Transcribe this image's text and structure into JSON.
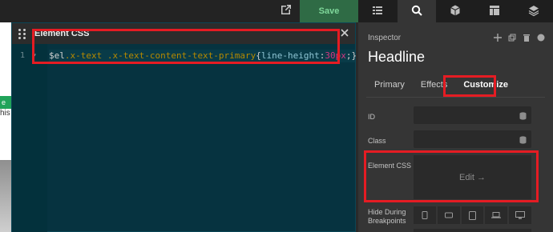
{
  "toolbar": {
    "save_label": "Save"
  },
  "inspector_tabs_icons": [
    "list-icon",
    "search-icon",
    "cube-icon",
    "layout-icon",
    "layers-icon"
  ],
  "background_page": {
    "green_label": "e",
    "text_fragment": "his"
  },
  "editor": {
    "title": "Element CSS",
    "line_number": "1",
    "code": {
      "var": "$el",
      "selector": ".x-text .x-text-content-text-primary",
      "open_brace": "{",
      "property": "line-height",
      "colon": ":",
      "value": "30px",
      "semicolon": ";",
      "close_brace": "}"
    }
  },
  "inspector": {
    "label": "Inspector",
    "title": "Headline",
    "tabs": [
      {
        "label": "Primary"
      },
      {
        "label": "Effects"
      },
      {
        "label": "Customize"
      }
    ],
    "fields": {
      "id_label": "ID",
      "class_label": "Class",
      "element_css_label": "Element CSS",
      "edit_label": "Edit →",
      "hide_bp_label_1": "Hide During",
      "hide_bp_label_2": "Breakpoints"
    }
  },
  "colors": {
    "editor_bg": "#063340",
    "save_green": "#2f6b45",
    "highlight_red": "#e51c23"
  }
}
